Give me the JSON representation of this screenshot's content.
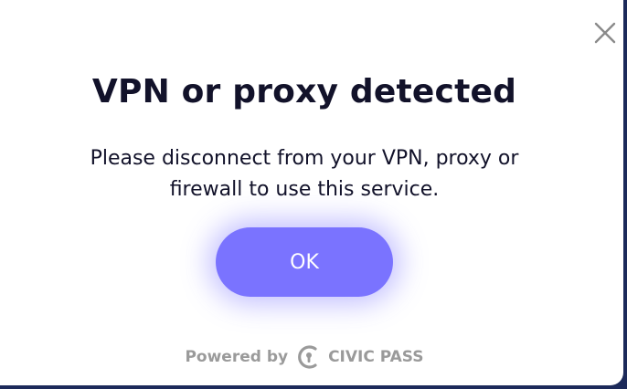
{
  "dialog": {
    "title": "VPN or proxy detected",
    "message": "Please disconnect from your VPN, proxy or firewall to use this service.",
    "ok_label": "OK",
    "close_icon": "close-icon"
  },
  "footer": {
    "powered_by": "Powered by",
    "brand": "CIVIC PASS",
    "logo_icon": "civic-logo-icon"
  },
  "colors": {
    "accent": "#7a73ff",
    "title": "#12122a",
    "footer_text": "#9a9a9a"
  }
}
